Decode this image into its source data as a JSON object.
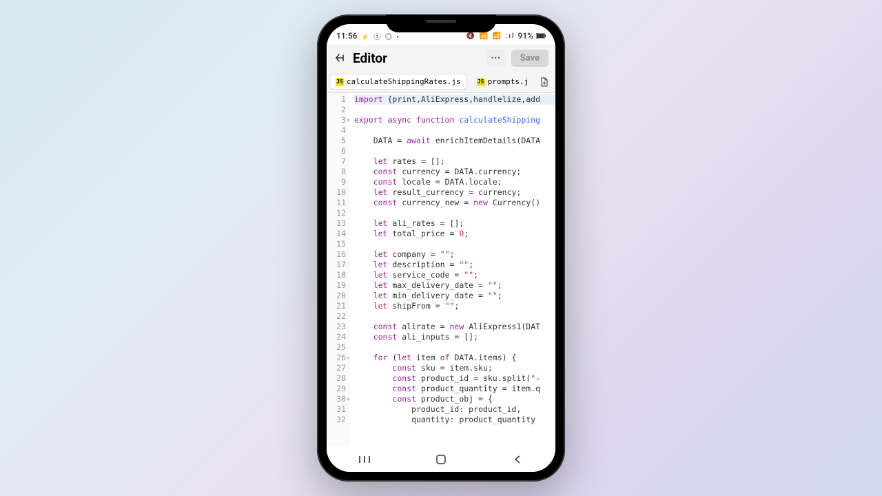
{
  "status": {
    "time": "11:56",
    "left_icons": "⚡ ⓣ ◎ •",
    "right_icons": "🔇 📶 📶 .ıl",
    "battery": "91%"
  },
  "header": {
    "title": "Editor",
    "more_label": "•••",
    "save_label": "Save"
  },
  "tabs": [
    {
      "icon": "JS",
      "label": "calculateShippingRates.js",
      "active": true
    },
    {
      "icon": "JS",
      "label": "prompts.j",
      "active": false
    }
  ],
  "gutter": [
    "1",
    "2",
    "3",
    "4",
    "5",
    "6",
    "7",
    "8",
    "9",
    "10",
    "11",
    "12",
    "13",
    "14",
    "15",
    "16",
    "17",
    "18",
    "19",
    "20",
    "21",
    "22",
    "23",
    "24",
    "25",
    "26",
    "27",
    "28",
    "29",
    "30",
    "31",
    "32"
  ],
  "folds": {
    "3": "▾",
    "26": "▾",
    "30": "▾"
  },
  "code": {
    "1": [
      [
        "kw",
        "import"
      ],
      [
        "op",
        " {print,AliExpress,handlelize,add"
      ]
    ],
    "2": [
      [
        "op",
        ""
      ]
    ],
    "3": [
      [
        "kw",
        "export "
      ],
      [
        "kw",
        "async "
      ],
      [
        "kw",
        "function "
      ],
      [
        "fn",
        "calculateShipping"
      ]
    ],
    "4": [
      [
        "op",
        ""
      ]
    ],
    "5": [
      [
        "op",
        "    DATA = "
      ],
      [
        "kw",
        "await"
      ],
      [
        "op",
        " enrichItemDetails(DATA"
      ]
    ],
    "6": [
      [
        "op",
        ""
      ]
    ],
    "7": [
      [
        "op",
        "    "
      ],
      [
        "kw",
        "let"
      ],
      [
        "op",
        " rates = [];"
      ]
    ],
    "8": [
      [
        "op",
        "    "
      ],
      [
        "kw",
        "const"
      ],
      [
        "op",
        " currency = DATA.currency;"
      ]
    ],
    "9": [
      [
        "op",
        "    "
      ],
      [
        "kw",
        "const"
      ],
      [
        "op",
        " locale = DATA.locale;"
      ]
    ],
    "10": [
      [
        "op",
        "    "
      ],
      [
        "kw",
        "let"
      ],
      [
        "op",
        " result_currency = currency;"
      ]
    ],
    "11": [
      [
        "op",
        "    "
      ],
      [
        "kw",
        "const"
      ],
      [
        "op",
        " currency_new = "
      ],
      [
        "kw",
        "new"
      ],
      [
        "op",
        " Currency()"
      ]
    ],
    "12": [
      [
        "op",
        ""
      ]
    ],
    "13": [
      [
        "op",
        "    "
      ],
      [
        "kw",
        "let"
      ],
      [
        "op",
        " ali_rates = [];"
      ]
    ],
    "14": [
      [
        "op",
        "    "
      ],
      [
        "kw",
        "let"
      ],
      [
        "op",
        " total_price = "
      ],
      [
        "num",
        "0"
      ],
      [
        "op",
        ";"
      ]
    ],
    "15": [
      [
        "op",
        ""
      ]
    ],
    "16": [
      [
        "op",
        "    "
      ],
      [
        "kw",
        "let"
      ],
      [
        "op",
        " company = "
      ],
      [
        "str",
        "\"\""
      ],
      [
        "op",
        ";"
      ]
    ],
    "17": [
      [
        "op",
        "    "
      ],
      [
        "kw",
        "let"
      ],
      [
        "op",
        " description = "
      ],
      [
        "str",
        "\"\""
      ],
      [
        "op",
        ";"
      ]
    ],
    "18": [
      [
        "op",
        "    "
      ],
      [
        "kw",
        "let"
      ],
      [
        "op",
        " service_code = "
      ],
      [
        "str",
        "\"\""
      ],
      [
        "op",
        ";"
      ]
    ],
    "19": [
      [
        "op",
        "    "
      ],
      [
        "kw",
        "let"
      ],
      [
        "op",
        " max_delivery_date = "
      ],
      [
        "str",
        "\"\""
      ],
      [
        "op",
        ";"
      ]
    ],
    "20": [
      [
        "op",
        "    "
      ],
      [
        "kw",
        "let"
      ],
      [
        "op",
        " min_delivery_date = "
      ],
      [
        "str",
        "\"\""
      ],
      [
        "op",
        ";"
      ]
    ],
    "21": [
      [
        "op",
        "    "
      ],
      [
        "kw",
        "let"
      ],
      [
        "op",
        " shipFrom = "
      ],
      [
        "str",
        "\"\""
      ],
      [
        "op",
        ";"
      ]
    ],
    "22": [
      [
        "op",
        ""
      ]
    ],
    "23": [
      [
        "op",
        "    "
      ],
      [
        "kw",
        "const"
      ],
      [
        "op",
        " alirate = "
      ],
      [
        "kw",
        "new"
      ],
      [
        "op",
        " AliExpress1(DAT"
      ]
    ],
    "24": [
      [
        "op",
        "    "
      ],
      [
        "kw",
        "const"
      ],
      [
        "op",
        " ali_inputs = [];"
      ]
    ],
    "25": [
      [
        "op",
        ""
      ]
    ],
    "26": [
      [
        "op",
        "    "
      ],
      [
        "kw",
        "for"
      ],
      [
        "op",
        " ("
      ],
      [
        "kw",
        "let"
      ],
      [
        "op",
        " item "
      ],
      [
        "kw",
        "of"
      ],
      [
        "op",
        " DATA.items) {"
      ]
    ],
    "27": [
      [
        "op",
        "        "
      ],
      [
        "kw",
        "const"
      ],
      [
        "op",
        " sku = item.sku;"
      ]
    ],
    "28": [
      [
        "op",
        "        "
      ],
      [
        "kw",
        "const"
      ],
      [
        "op",
        " product_id = sku.split("
      ],
      [
        "str",
        "\"-"
      ]
    ],
    "29": [
      [
        "op",
        "        "
      ],
      [
        "kw",
        "const"
      ],
      [
        "op",
        " product_quantity = item.q"
      ]
    ],
    "30": [
      [
        "op",
        "        "
      ],
      [
        "kw",
        "const"
      ],
      [
        "op",
        " product_obj = {"
      ]
    ],
    "31": [
      [
        "op",
        "            product_id: product_id,"
      ]
    ],
    "32": [
      [
        "op",
        "            quantity: product_quantity"
      ]
    ]
  }
}
